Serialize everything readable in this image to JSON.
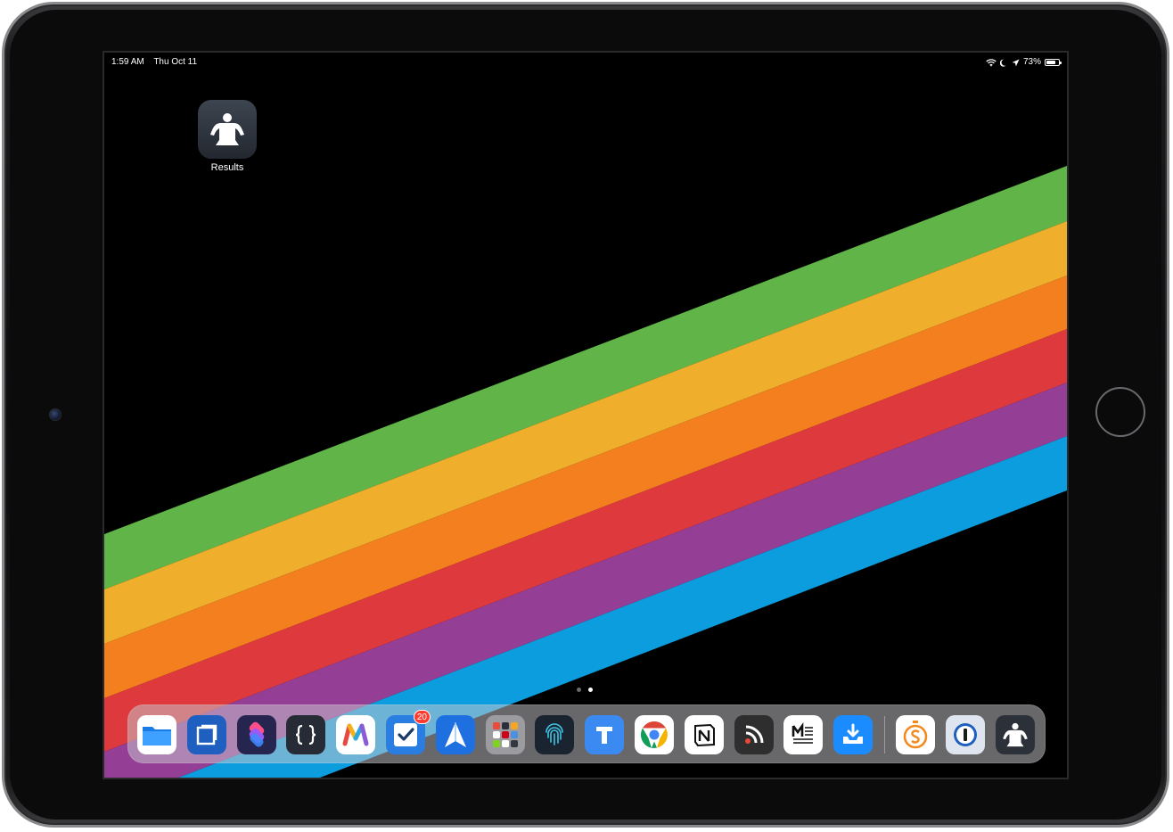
{
  "status_bar": {
    "time": "1:59 AM",
    "date": "Thu Oct 11",
    "battery_percent": "73%",
    "battery_level": 0.73
  },
  "home_screen": {
    "apps": [
      {
        "label": "Results",
        "icon": "person-silhouette-icon"
      }
    ],
    "page_count": 2,
    "current_page": 2
  },
  "dock": {
    "apps": [
      {
        "icon": "files-icon",
        "color": "#1a8cff"
      },
      {
        "icon": "square-frame-icon",
        "color": "#1e6fd9"
      },
      {
        "icon": "shortcuts-icon",
        "color": "#3a2f6b"
      },
      {
        "icon": "braces-icon",
        "color": "#2c3340"
      },
      {
        "icon": "colorful-m-icon",
        "color": "#ffffff"
      },
      {
        "icon": "checkbox-icon",
        "color": "#2a7de1",
        "badge": "20"
      },
      {
        "icon": "paper-plane-icon",
        "color": "#1d6fe0"
      },
      {
        "icon": "app-folder-grid-icon",
        "color": "#8e8e93"
      },
      {
        "icon": "fingerprint-icon",
        "color": "#1c2a3a"
      },
      {
        "icon": "letter-t-icon",
        "color": "#3b8af2"
      },
      {
        "icon": "chrome-icon",
        "color": "#ffffff"
      },
      {
        "icon": "notion-icon",
        "color": "#ffffff"
      },
      {
        "icon": "rss-feed-icon",
        "color": "#2b2b2b"
      },
      {
        "icon": "document-m-icon",
        "color": "#ffffff"
      },
      {
        "icon": "download-tray-icon",
        "color": "#1a8cff"
      }
    ],
    "recent_apps": [
      {
        "icon": "stopwatch-s-icon",
        "color": "#ffffff"
      },
      {
        "icon": "password-keyhole-icon",
        "color": "#d7dde6"
      },
      {
        "icon": "person-silhouette-icon",
        "color": "#2c3038"
      }
    ]
  }
}
